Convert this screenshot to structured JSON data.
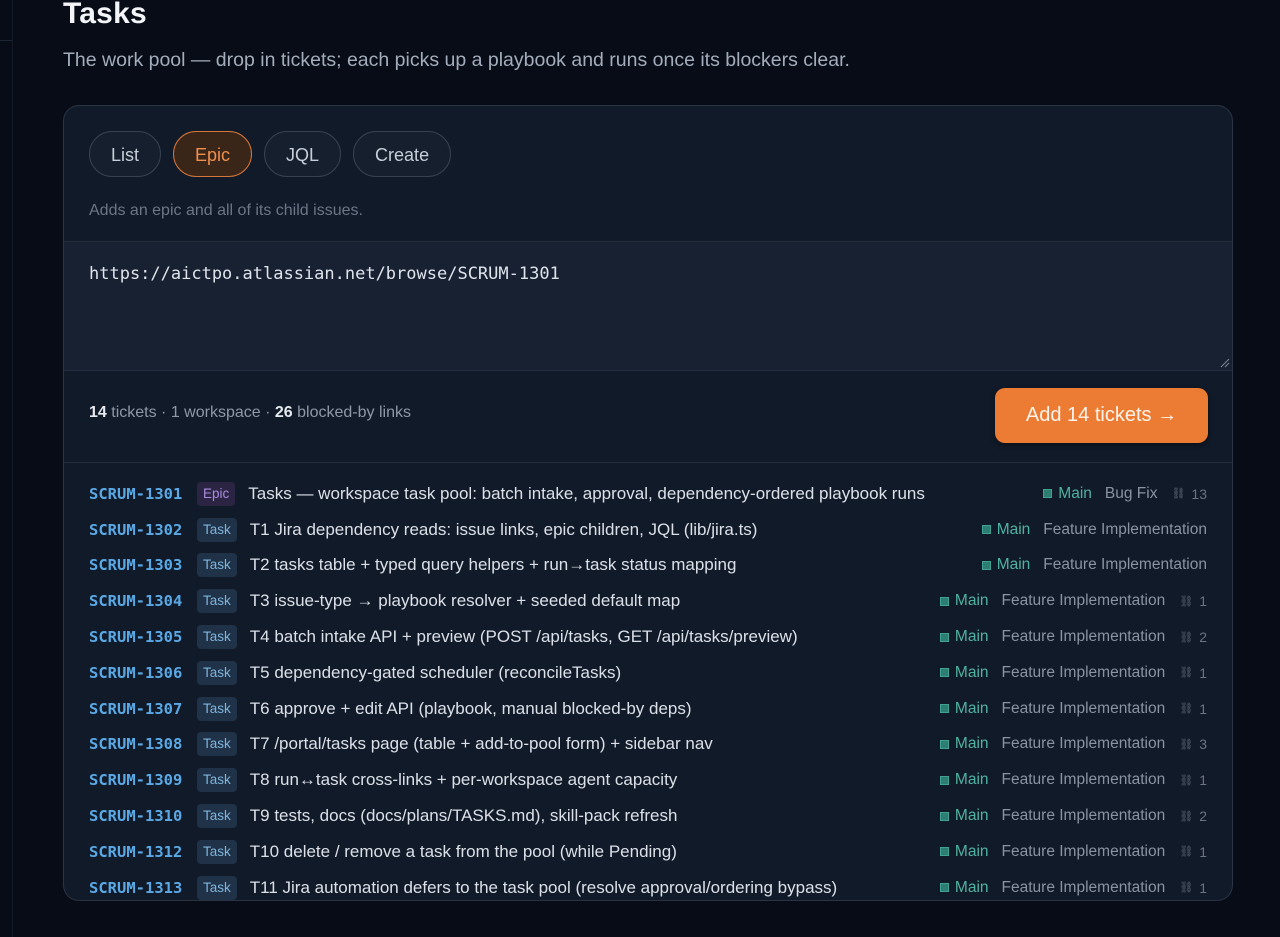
{
  "page": {
    "title": "Tasks",
    "subtitle": "The work pool — drop in tickets; each picks up a playbook and runs once its blockers clear."
  },
  "tabs": [
    {
      "label": "List",
      "active": false
    },
    {
      "label": "Epic",
      "active": true
    },
    {
      "label": "JQL",
      "active": false
    },
    {
      "label": "Create",
      "active": false
    }
  ],
  "mode_hint": "Adds an epic and all of its child issues.",
  "input": {
    "value": "https://aictpo.atlassian.net/browse/SCRUM-1301"
  },
  "summary": {
    "ticket_count": "14",
    "tickets_label": "tickets",
    "sep1": "·",
    "workspace_text": "1 workspace",
    "sep2": "·",
    "links_count": "26",
    "links_label": "blocked-by links"
  },
  "add_button": {
    "label": "Add 14 tickets →"
  },
  "colors": {
    "accent": "#ec7c33",
    "key": "#5aa9e6",
    "workspace": "#4fb3a2",
    "epic_badge": "#a88be0",
    "task_badge": "#7fb4de"
  },
  "icons": {
    "workspace": "square-icon",
    "blockers": "link-icon"
  },
  "tickets": [
    {
      "key": "SCRUM-1301",
      "type": "Epic",
      "summary": "Tasks — workspace task pool: batch intake, approval, dependency-ordered playbook runs",
      "workspace": "Main",
      "playbook": "Bug Fix",
      "blockers": "13"
    },
    {
      "key": "SCRUM-1302",
      "type": "Task",
      "summary": "T1 Jira dependency reads: issue links, epic children, JQL (lib/jira.ts)",
      "workspace": "Main",
      "playbook": "Feature Implementation",
      "blockers": ""
    },
    {
      "key": "SCRUM-1303",
      "type": "Task",
      "summary": "T2 tasks table + typed query helpers + run→task status mapping",
      "workspace": "Main",
      "playbook": "Feature Implementation",
      "blockers": ""
    },
    {
      "key": "SCRUM-1304",
      "type": "Task",
      "summary": "T3 issue-type → playbook resolver + seeded default map",
      "workspace": "Main",
      "playbook": "Feature Implementation",
      "blockers": "1"
    },
    {
      "key": "SCRUM-1305",
      "type": "Task",
      "summary": "T4 batch intake API + preview (POST /api/tasks, GET /api/tasks/preview)",
      "workspace": "Main",
      "playbook": "Feature Implementation",
      "blockers": "2"
    },
    {
      "key": "SCRUM-1306",
      "type": "Task",
      "summary": "T5 dependency-gated scheduler (reconcileTasks)",
      "workspace": "Main",
      "playbook": "Feature Implementation",
      "blockers": "1"
    },
    {
      "key": "SCRUM-1307",
      "type": "Task",
      "summary": "T6 approve + edit API (playbook, manual blocked-by deps)",
      "workspace": "Main",
      "playbook": "Feature Implementation",
      "blockers": "1"
    },
    {
      "key": "SCRUM-1308",
      "type": "Task",
      "summary": "T7 /portal/tasks page (table + add-to-pool form) + sidebar nav",
      "workspace": "Main",
      "playbook": "Feature Implementation",
      "blockers": "3"
    },
    {
      "key": "SCRUM-1309",
      "type": "Task",
      "summary": "T8 run↔task cross-links + per-workspace agent capacity",
      "workspace": "Main",
      "playbook": "Feature Implementation",
      "blockers": "1"
    },
    {
      "key": "SCRUM-1310",
      "type": "Task",
      "summary": "T9 tests, docs (docs/plans/TASKS.md), skill-pack refresh",
      "workspace": "Main",
      "playbook": "Feature Implementation",
      "blockers": "2"
    },
    {
      "key": "SCRUM-1312",
      "type": "Task",
      "summary": "T10 delete / remove a task from the pool (while Pending)",
      "workspace": "Main",
      "playbook": "Feature Implementation",
      "blockers": "1"
    },
    {
      "key": "SCRUM-1313",
      "type": "Task",
      "summary": "T11 Jira automation defers to the task pool (resolve approval/ordering bypass)",
      "workspace": "Main",
      "playbook": "Feature Implementation",
      "blockers": "1"
    }
  ]
}
